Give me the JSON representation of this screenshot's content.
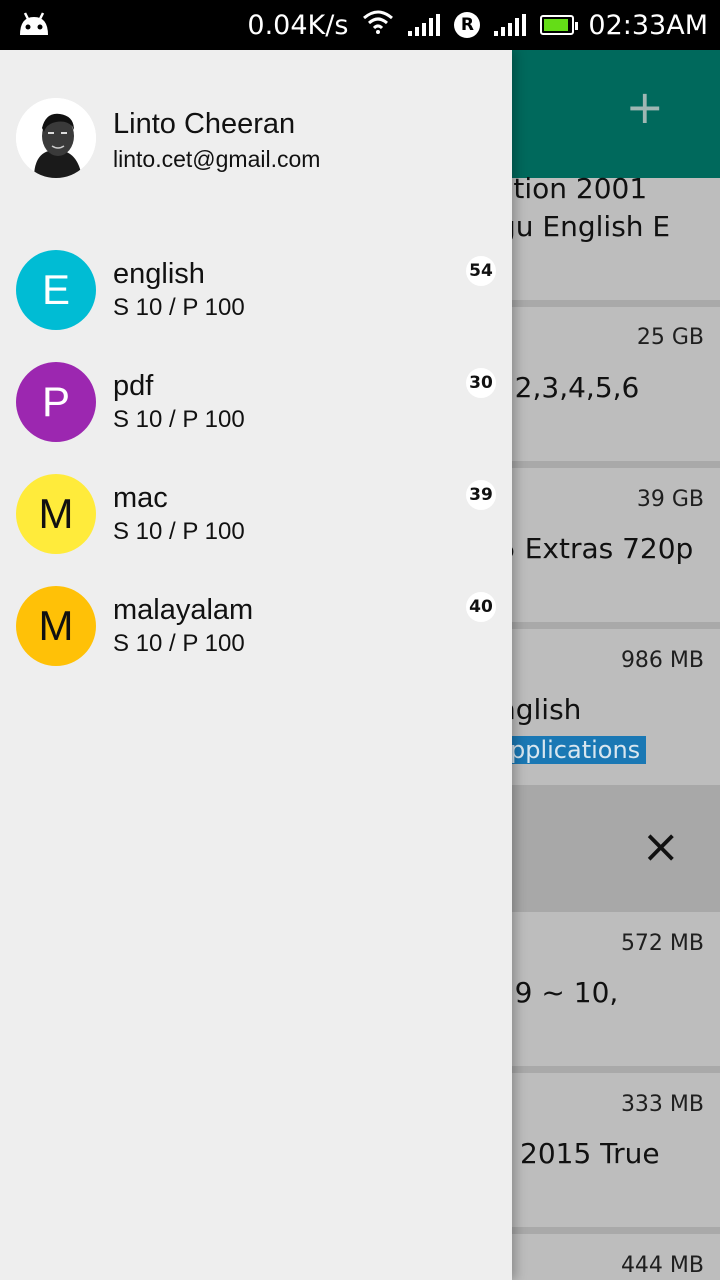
{
  "status_bar": {
    "net_speed": "0.04K/s",
    "roaming_badge": "R",
    "time": "02:33AM",
    "icons": [
      "android-icon",
      "wifi-icon",
      "signal-icon",
      "battery-icon"
    ]
  },
  "drawer": {
    "profile": {
      "name": "Linto Cheeran",
      "email": "linto.cet@gmail.com"
    },
    "items": [
      {
        "letter": "E",
        "title": "english",
        "subtitle": "S 10 / P 100",
        "count": "54",
        "color": "#00bcd4",
        "text_color": "#ffffff"
      },
      {
        "letter": "P",
        "title": "pdf",
        "subtitle": "S 10 / P 100",
        "count": "30",
        "color": "#9c27b0",
        "text_color": "#ffffff"
      },
      {
        "letter": "M",
        "title": "mac",
        "subtitle": "S 10 / P 100",
        "count": "39",
        "color": "#ffeb3b",
        "text_color": "#111111"
      },
      {
        "letter": "M",
        "title": "malayalam",
        "subtitle": "S 10 / P 100",
        "count": "40",
        "color": "#ffc107",
        "text_color": "#111111"
      }
    ]
  },
  "background_app": {
    "toolbar_color": "#00695c",
    "add_label": "+",
    "close_label": "×",
    "cards": [
      {
        "size": "",
        "line1": "ction 2001",
        "line2": "gu English E"
      },
      {
        "size": "25 GB",
        "line1": "l,2,3,4,5,6"
      },
      {
        "size": "39 GB",
        "line1": "5 Extras 720p"
      },
      {
        "size": "986 MB",
        "line1": "nglish",
        "tag": "pplications"
      },
      {
        "size": "572 MB",
        "line1": "l 9 ~ 10,"
      },
      {
        "size": "333 MB",
        "line1": "2015 True"
      },
      {
        "size": "444 MB"
      }
    ]
  }
}
